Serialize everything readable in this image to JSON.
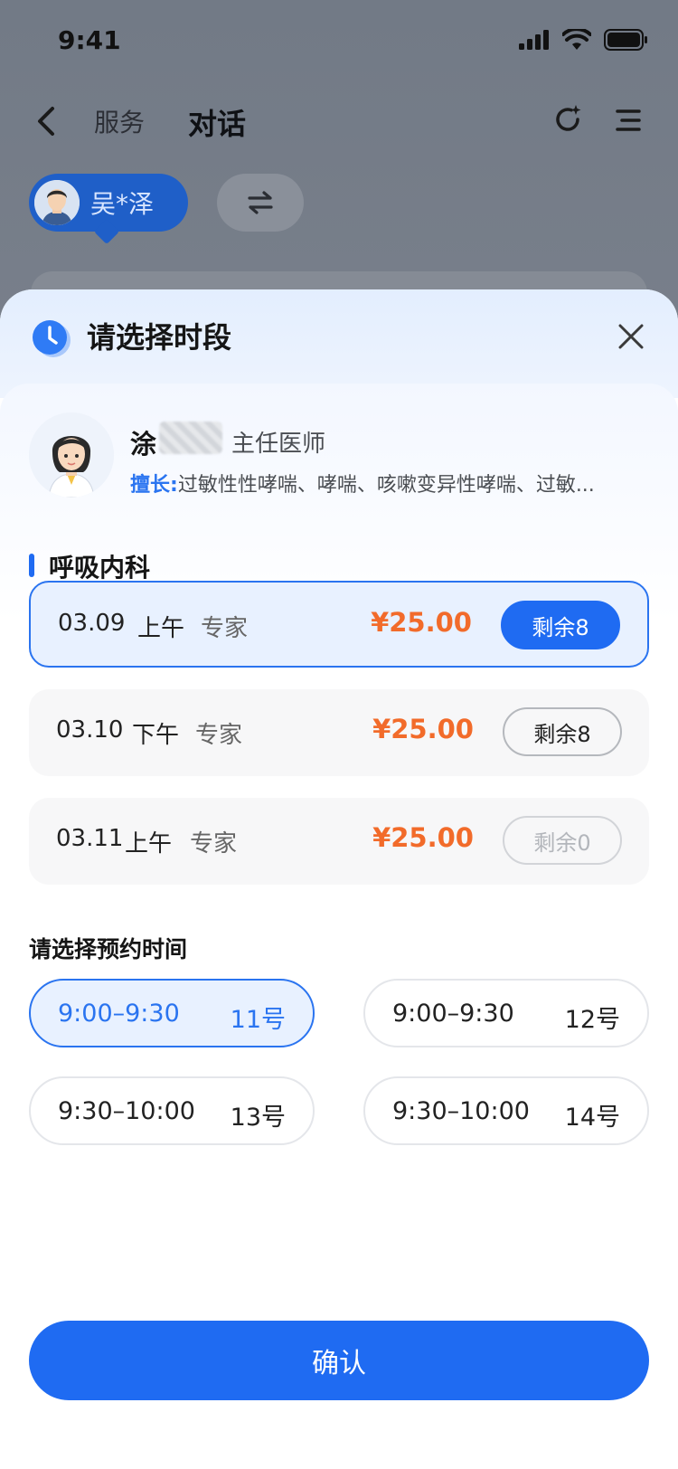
{
  "status_bar": {
    "time": "9:41"
  },
  "nav": {
    "tab_service": "服务",
    "tab_chat": "对话"
  },
  "patient": {
    "name": "吴*泽"
  },
  "sheet": {
    "title": "请选择时段",
    "doctor": {
      "surname": "涂",
      "title": "主任医师",
      "skill_label": "擅长:",
      "skill_text": "过敏性性哮喘、哮喘、咳嗽变异性哮喘、过敏..."
    },
    "department": "呼吸内科",
    "slots": [
      {
        "date": "03.09",
        "period": "上午",
        "type": "专家",
        "price": "¥25.00",
        "remain": "剩余8",
        "selected": true
      },
      {
        "date": "03.10",
        "period": "下午",
        "type": "专家",
        "price": "¥25.00",
        "remain": "剩余8",
        "selected": false
      },
      {
        "date": "03.11",
        "period": "上午",
        "type": "专家",
        "price": "¥25.00",
        "remain": "剩余0",
        "selected": false
      }
    ],
    "time_heading": "请选择预约时间",
    "times": [
      {
        "time": "9:00–9:30",
        "number": "11号",
        "selected": true
      },
      {
        "time": "9:00–9:30",
        "number": "12号",
        "selected": false
      },
      {
        "time": "9:30–10:00",
        "number": "13号",
        "selected": false
      },
      {
        "time": "9:30–10:00",
        "number": "14号",
        "selected": false
      }
    ],
    "confirm_label": "确认"
  },
  "colors": {
    "accent": "#1f6bf2",
    "price": "#f26b2a",
    "selected_bg": "#e8f1ff"
  }
}
